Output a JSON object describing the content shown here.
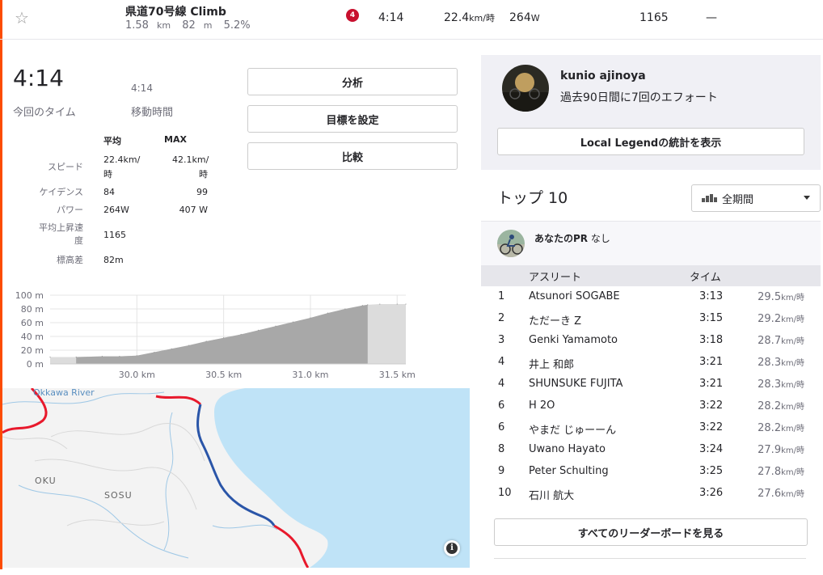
{
  "segment_row": {
    "name": "県道70号線 Climb",
    "distance": "1.58",
    "distance_unit": "km",
    "elev_gain": "82",
    "elev_unit": "m",
    "grade": "5.2%",
    "category": "4",
    "time": "4:14",
    "speed": "22.4",
    "speed_unit": "km/時",
    "power": "264",
    "power_unit": "W",
    "vam": "1165",
    "hr": "—"
  },
  "summary": {
    "elapsed_time": "4:14",
    "elapsed_label": "今回のタイム",
    "moving_time": "4:14",
    "moving_label": "移動時間"
  },
  "stats": {
    "avg_header": "平均",
    "max_header": "MAX",
    "speed_label": "スピード",
    "speed_avg": "22.4km/",
    "speed_avg2": "時",
    "speed_max": "42.1km/",
    "speed_max2": "時",
    "cadence_label": "ケイデンス",
    "cadence_avg": "84",
    "cadence_max": "99",
    "power_label": "パワー",
    "power_avg": "264W",
    "power_max": "407 W",
    "vam_label1": "平均上昇速",
    "vam_label2": "度",
    "vam_avg": "1165",
    "elev_label": "標高差",
    "elev_avg": "82m"
  },
  "buttons": {
    "analyze": "分析",
    "set_goal": "目標を設定",
    "compare": "比較"
  },
  "chart_data": {
    "type": "area",
    "title": "",
    "xlabel": "",
    "ylabel": "",
    "x_unit": "km",
    "y_unit": "m",
    "xlim": [
      29.5,
      31.55
    ],
    "ylim": [
      0,
      100
    ],
    "x_ticks": [
      "30.0 km",
      "30.5 km",
      "31.0 km",
      "31.5 km"
    ],
    "y_ticks": [
      "100 m",
      "80 m",
      "60 m",
      "40 m",
      "20 m",
      "0 m"
    ],
    "segment_range": [
      29.65,
      31.33
    ],
    "x": [
      29.5,
      29.65,
      29.8,
      29.9,
      30.0,
      30.1,
      30.2,
      30.3,
      30.4,
      30.5,
      30.6,
      30.7,
      30.8,
      30.9,
      31.0,
      31.1,
      31.2,
      31.3,
      31.33,
      31.4,
      31.5,
      31.55
    ],
    "y": [
      10,
      10,
      11,
      11,
      12,
      17,
      22,
      27,
      33,
      38,
      43,
      49,
      55,
      61,
      67,
      74,
      80,
      85,
      86,
      87,
      87,
      87
    ]
  },
  "map": {
    "river_label": "Okkawa River",
    "place1": "OKU",
    "place2": "SOSU",
    "info_glyph": "i"
  },
  "legend": {
    "athlete": "kunio ajinoya",
    "efforts": "過去90日間に7回のエフォート",
    "stats_button": "Local Legendの統計を表示"
  },
  "leaderboard": {
    "title": "トップ 10",
    "period": "全期間",
    "pr_label": "あなたのPR",
    "pr_value": "なし",
    "col_athlete": "アスリート",
    "col_time": "タイム",
    "speed_unit": "km/時",
    "rows": [
      {
        "rank": "1",
        "name": "Atsunori SOGABE",
        "time": "3:13",
        "speed": "29.5"
      },
      {
        "rank": "2",
        "name": "ただーき Z",
        "time": "3:15",
        "speed": "29.2"
      },
      {
        "rank": "3",
        "name": "Genki Yamamoto",
        "time": "3:18",
        "speed": "28.7"
      },
      {
        "rank": "4",
        "name": "井上 和郎",
        "time": "3:21",
        "speed": "28.3"
      },
      {
        "rank": "4",
        "name": "SHUNSUKE FUJITA",
        "time": "3:21",
        "speed": "28.3"
      },
      {
        "rank": "6",
        "name": "H 2O",
        "time": "3:22",
        "speed": "28.2"
      },
      {
        "rank": "6",
        "name": "やまだ じゅーーん",
        "time": "3:22",
        "speed": "28.2"
      },
      {
        "rank": "8",
        "name": "Uwano Hayato",
        "time": "3:24",
        "speed": "27.9"
      },
      {
        "rank": "9",
        "name": "Peter Schulting",
        "time": "3:25",
        "speed": "27.8"
      },
      {
        "rank": "10",
        "name": "石川 航大",
        "time": "3:26",
        "speed": "27.6"
      }
    ],
    "view_all": "すべてのリーダーボードを見る"
  },
  "colors": {
    "accent": "#fc4c02",
    "route": "#2a55a8",
    "road": "#e8192c",
    "water": "#bfe3f7"
  }
}
